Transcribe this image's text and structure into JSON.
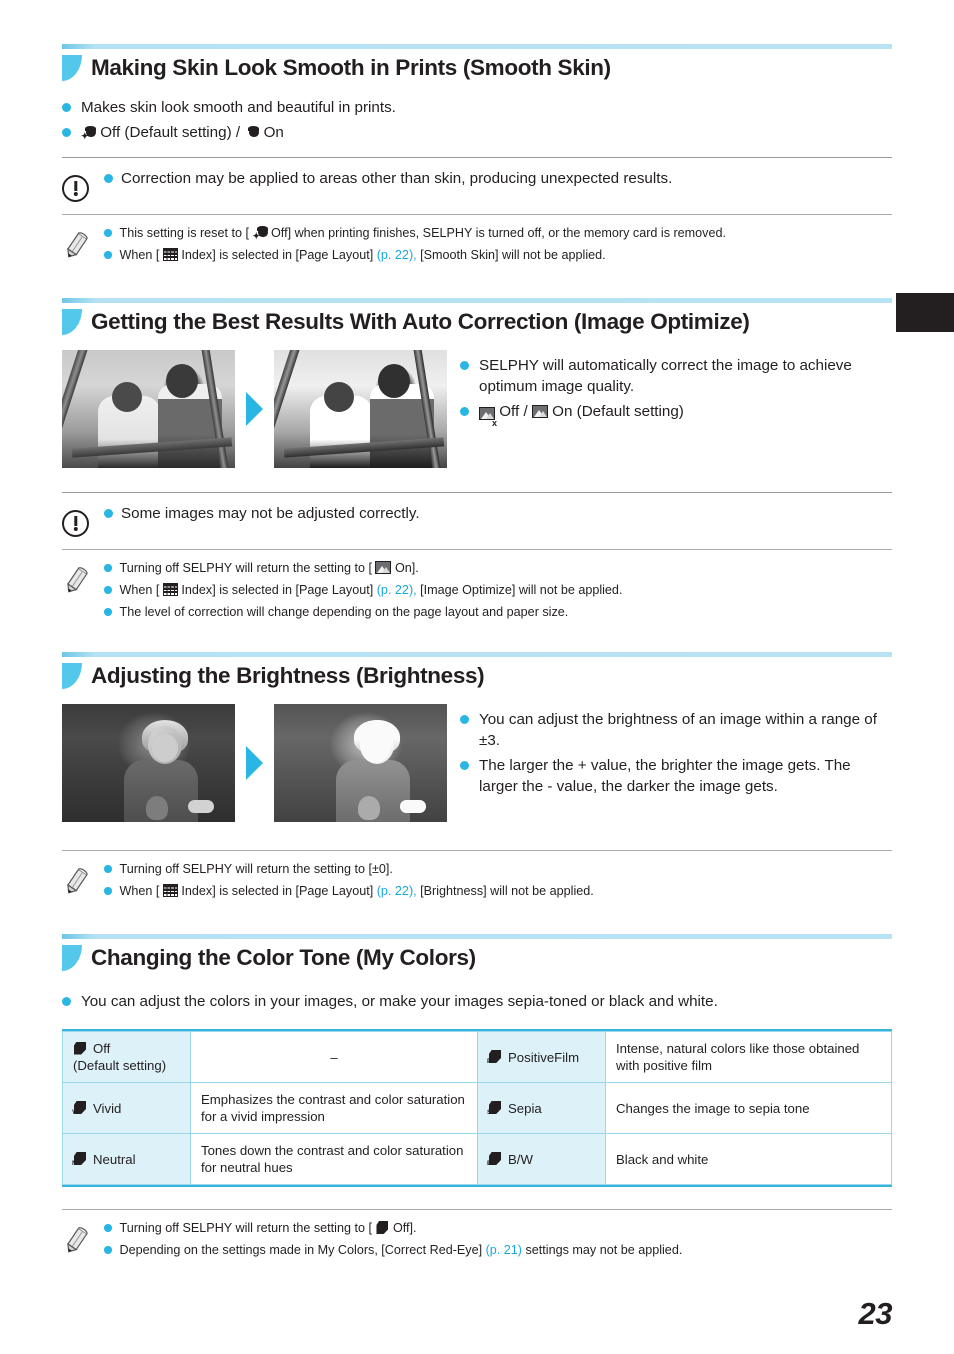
{
  "page": {
    "number": "23"
  },
  "sections": [
    {
      "id": "smooth-skin",
      "title": "Making Skin Look Smooth in Prints (Smooth Skin)",
      "bullets": [
        "Makes skin look smooth and beautiful in prints.",
        "Off (Default setting) / On"
      ],
      "setting_off": "Off (Default setting)",
      "setting_sep": "/",
      "setting_on": "On",
      "caution": [
        "Correction may be applied to areas other than skin, producing unexpected results."
      ],
      "notes": [
        {
          "pre": "This setting is reset to [",
          "icon": "smooth-skin-off-icon",
          "mid": "Off] when printing finishes, SELPHY is turned off, or the memory card is removed.",
          "post": ""
        },
        {
          "pre": "When [",
          "icon": "index-grid-icon",
          "mid": "Index] is selected in [Page Layout]",
          "link": "(p. 22),",
          "post": "[Smooth Skin] will not be applied."
        }
      ]
    },
    {
      "id": "image-optimize",
      "title": "Getting the Best Results With Auto Correction (Image Optimize)",
      "bullets": [
        "SELPHY will automatically correct the image to achieve optimum image quality."
      ],
      "setting_off": "Off",
      "setting_sep": "/",
      "setting_on": "On (Default setting)",
      "caution": [
        "Some images may not be adjusted correctly."
      ],
      "notes": [
        {
          "pre": "Turning off SELPHY will return the setting to [",
          "icon": "image-optimize-on-icon",
          "mid": "On].",
          "post": ""
        },
        {
          "pre": "When [",
          "icon": "index-grid-icon",
          "mid": "Index] is selected in [Page Layout]",
          "link": "(p. 22),",
          "post": "[Image Optimize] will not be applied."
        },
        {
          "plain": "The level of correction will change depending on the page layout and paper size."
        }
      ]
    },
    {
      "id": "brightness",
      "title": "Adjusting the Brightness (Brightness)",
      "bullets": [
        "You can adjust the brightness of an image within a range of ±3.",
        "The larger the + value, the brighter the image gets. The larger the - value, the darker the image gets."
      ],
      "notes": [
        {
          "plain": "Turning off SELPHY will return the setting to [±0]."
        },
        {
          "pre": "When [",
          "icon": "index-grid-icon",
          "mid": "Index] is selected in [Page Layout]",
          "link": "(p. 22),",
          "post": "[Brightness] will not be applied."
        }
      ]
    },
    {
      "id": "my-colors",
      "title": "Changing the Color Tone (My Colors)",
      "bullets": [
        "You can adjust the colors in your images, or make your images sepia-toned or black and white."
      ],
      "notes": [
        {
          "pre": "Turning off SELPHY will return the setting to [",
          "icon": "my-colors-off-icon",
          "mid": "Off].",
          "post": ""
        },
        {
          "pre": "Depending on the settings made in My Colors, [Correct Red-Eye]",
          "link": "(p. 21)",
          "post": "settings may not be applied."
        }
      ]
    }
  ],
  "my_colors_table": {
    "rows": [
      {
        "left_label": "Off",
        "left_sub": "(Default setting)",
        "left_icon": "my-colors-off-icon",
        "left_desc": "–",
        "right_label": "PositiveFilm",
        "right_icon": "my-colors-positivefilm-icon",
        "right_desc": "Intense, natural colors like those obtained with positive film"
      },
      {
        "left_label": "Vivid",
        "left_sub": "",
        "left_icon": "my-colors-vivid-icon",
        "left_desc": "Emphasizes the contrast and color saturation for a vivid impression",
        "right_label": "Sepia",
        "right_icon": "my-colors-sepia-icon",
        "right_desc": "Changes the image to sepia tone"
      },
      {
        "left_label": "Neutral",
        "left_sub": "",
        "left_icon": "my-colors-neutral-icon",
        "left_desc": "Tones down the contrast and color saturation for neutral hues",
        "right_label": "B/W",
        "right_icon": "my-colors-bw-icon",
        "right_desc": "Black and white"
      }
    ]
  },
  "icons": {
    "section_marker": "section-marker-icon",
    "bullet": "bullet-dot-icon",
    "caution": "caution-exclamation-icon",
    "note": "pencil-note-icon",
    "arrow": "example-arrow-icon"
  },
  "colors": {
    "accent_cyan": "#29b6e3",
    "rule_light_blue": "#b8e3f5",
    "table_header_fill": "#ddf1f9",
    "table_border": "#9bd7ea",
    "table_edge": "#35b4dd",
    "text": "#231f20",
    "link": "#19a8dd",
    "edge_tab": "#231f20"
  }
}
